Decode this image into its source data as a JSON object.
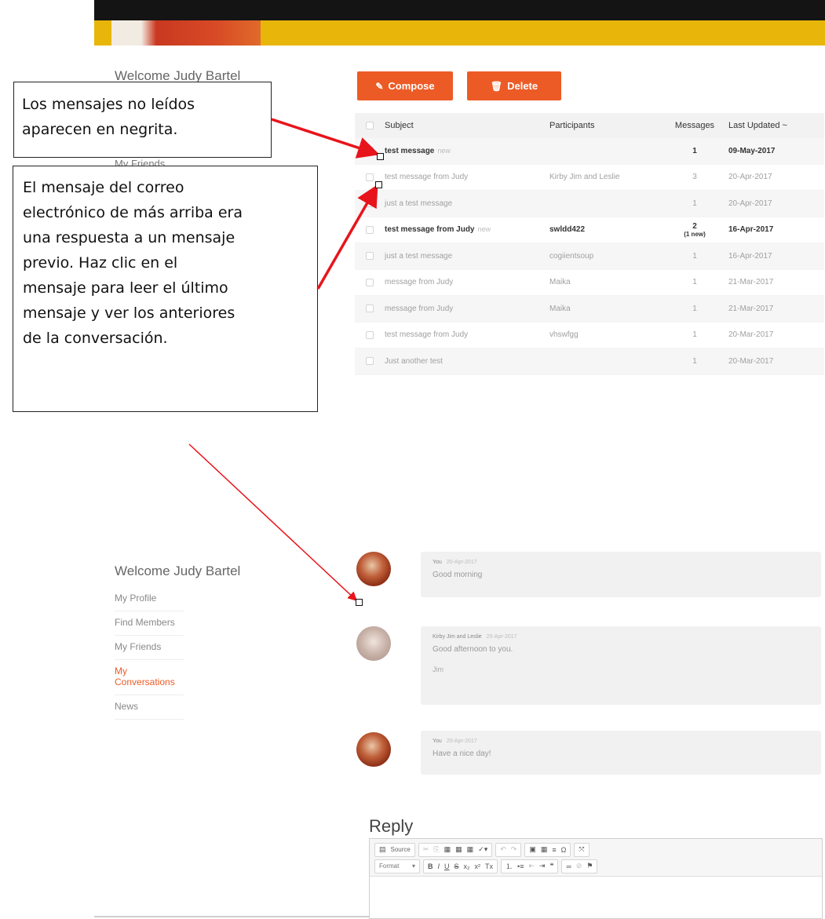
{
  "callouts": {
    "unread": {
      "line1": "Los mensajes no leídos",
      "line2": "aparecen en negrita."
    },
    "reply": {
      "lines": [
        "El mensaje del correo",
        "electrónico de más arriba era",
        "una respuesta a un mensaje",
        "previo.  Haz clic en el",
        "mensaje para leer el último",
        "mensaje y ver los anteriores",
        "de la conversación."
      ]
    }
  },
  "top_sidebar": {
    "welcome": "Welcome Judy Bartel",
    "friends": "My Friends"
  },
  "toolbar": {
    "compose_label": "Compose",
    "delete_label": "Delete"
  },
  "table": {
    "headers": {
      "subject": "Subject",
      "participants": "Participants",
      "messages": "Messages",
      "updated": "Last Updated ~"
    },
    "rows": [
      {
        "subject": "test message",
        "new_tag": "new",
        "participants": "",
        "messages": "1",
        "new_count": "",
        "date": "09-May-2017"
      },
      {
        "subject": "test message from Judy",
        "new_tag": "",
        "participants": "Kirby Jim and Leslie",
        "messages": "3",
        "new_count": "",
        "date": "20-Apr-2017"
      },
      {
        "subject": "just a test message",
        "new_tag": "",
        "participants": "",
        "messages": "1",
        "new_count": "",
        "date": "20-Apr-2017"
      },
      {
        "subject": "test message from Judy",
        "new_tag": "new",
        "participants": "swldd422",
        "messages": "2",
        "new_count": "(1 new)",
        "date": "16-Apr-2017"
      },
      {
        "subject": "just a test message",
        "new_tag": "",
        "participants": "cogiientsoup",
        "messages": "1",
        "new_count": "",
        "date": "16-Apr-2017"
      },
      {
        "subject": "message from Judy",
        "new_tag": "",
        "participants": "Maika",
        "messages": "1",
        "new_count": "",
        "date": "21-Mar-2017"
      },
      {
        "subject": "message from Judy",
        "new_tag": "",
        "participants": "Maika",
        "messages": "1",
        "new_count": "",
        "date": "21-Mar-2017"
      },
      {
        "subject": "test message from Judy",
        "new_tag": "",
        "participants": "vhswfgg",
        "messages": "1",
        "new_count": "",
        "date": "20-Mar-2017"
      },
      {
        "subject": "Just another test",
        "new_tag": "",
        "participants": "",
        "messages": "1",
        "new_count": "",
        "date": "20-Mar-2017"
      }
    ]
  },
  "sidebar": {
    "welcome": "Welcome Judy Bartel",
    "items": [
      {
        "label": "My Profile"
      },
      {
        "label": "Find Members"
      },
      {
        "label": "My Friends"
      },
      {
        "label": "My Conversations"
      },
      {
        "label": "News"
      }
    ]
  },
  "messages": [
    {
      "author": "You",
      "date": "20-Apr-2017",
      "body": "Good morning",
      "signature": ""
    },
    {
      "author": "Kirby Jim and Leslie",
      "date": "20-Apr-2017",
      "body": "Good afternoon to you.",
      "signature": "Jim"
    },
    {
      "author": "You",
      "date": "20-Apr-2017",
      "body": "Have a nice day!",
      "signature": ""
    }
  ],
  "reply": {
    "title": "Reply",
    "source_label": "Source",
    "format_label": "Format"
  },
  "colors": {
    "accent": "#ec5b26",
    "banner_yellow": "#e8b60a",
    "banner_dark": "#141414",
    "arrow": "#e8141b"
  }
}
